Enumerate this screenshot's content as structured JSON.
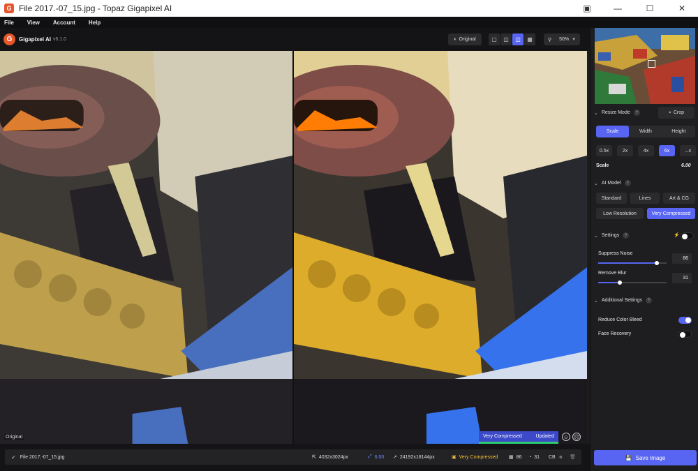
{
  "window": {
    "title": "File 2017.-07_15.jpg - Topaz Gigapixel AI"
  },
  "menu": [
    "File",
    "View",
    "Account",
    "Help"
  ],
  "header": {
    "brand": "Gigapixel AI",
    "version": "v6.1.0",
    "original_label": "Original",
    "zoom": "50%"
  },
  "viewer": {
    "left_label": "Original",
    "status_model": "Very Compressed",
    "status_state": "Updated"
  },
  "bottom": {
    "filename": "File 2017.-07_15.jpg",
    "input_size": "4032x3024px",
    "scale": "6.00",
    "output_size": "24192x18144px",
    "model": "Very Compressed",
    "noise": "86",
    "blur": "31",
    "cb": "CB"
  },
  "sidebar": {
    "resize_mode": "Resize Mode",
    "crop": "Crop",
    "resize_tabs": [
      "Scale",
      "Width",
      "Height"
    ],
    "scale_chips": [
      "0.5x",
      "2x",
      "4x",
      "6x",
      "...x"
    ],
    "scale_label": "Scale",
    "scale_value": "6.00",
    "ai_model": "AI Model",
    "models": [
      "Standard",
      "Lines",
      "Art & CG",
      "Low Resolution",
      "Very Compressed"
    ],
    "settings": "Settings",
    "suppress_noise": "Suppress Noise",
    "suppress_noise_value": "86",
    "remove_blur": "Remove Blur",
    "remove_blur_value": "31",
    "additional_settings": "Additional Settings",
    "reduce_color_bleed": "Reduce Color Bleed",
    "face_recovery": "Face Recovery",
    "save_label": "Save Image"
  },
  "colors": {
    "accent": "#5865f2",
    "status_green": "#2ecc71",
    "brand_orange": "#e8562a"
  }
}
